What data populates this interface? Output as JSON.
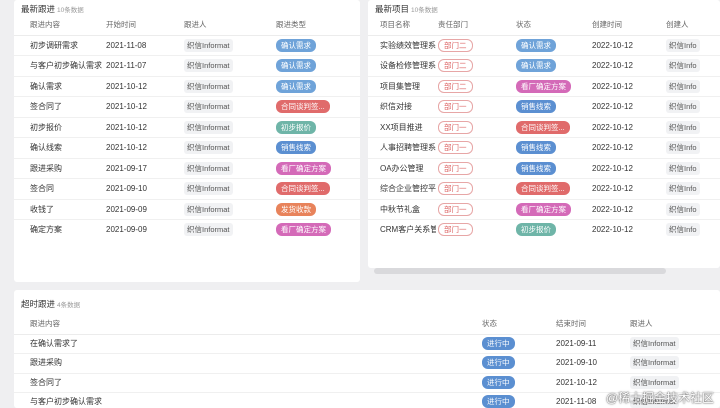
{
  "colors": {
    "需求": "#6fa3d9",
    "确认需求": "#6fa3d9",
    "合同谈判签": "#e06b6b",
    "初步报价": "#6fb5a8",
    "销售线索": "#5b8fd1",
    "看厂确定方案": "#d46ab8",
    "发货收款": "#e8835b",
    "进行中": "#5b8fd1"
  },
  "recent_followups": {
    "title": "最新跟进",
    "count": "10条数据",
    "headers": [
      "跟进内容",
      "开始时间",
      "跟进人",
      "跟进类型"
    ],
    "rows": [
      {
        "content": "初步调研需求",
        "time": "2021-11-08",
        "person": "织信Informat",
        "type": "确认需求",
        "type_key": "确认需求"
      },
      {
        "content": "与客户初步确认需求",
        "time": "2021-11-07",
        "person": "织信Informat",
        "type": "确认需求",
        "type_key": "确认需求"
      },
      {
        "content": "确认需求",
        "time": "2021-10-12",
        "person": "织信Informat",
        "type": "确认需求",
        "type_key": "确认需求"
      },
      {
        "content": "签合同了",
        "time": "2021-10-12",
        "person": "织信Informat",
        "type": "合同谈判签...",
        "type_key": "合同谈判签"
      },
      {
        "content": "初步报价",
        "time": "2021-10-12",
        "person": "织信Informat",
        "type": "初步报价",
        "type_key": "初步报价"
      },
      {
        "content": "确认线索",
        "time": "2021-10-12",
        "person": "织信Informat",
        "type": "销售线索",
        "type_key": "销售线索"
      },
      {
        "content": "跟进采购",
        "time": "2021-09-17",
        "person": "织信Informat",
        "type": "看厂确定方案",
        "type_key": "看厂确定方案"
      },
      {
        "content": "签合同",
        "time": "2021-09-10",
        "person": "织信Informat",
        "type": "合同谈判签...",
        "type_key": "合同谈判签"
      },
      {
        "content": "收钱了",
        "time": "2021-09-09",
        "person": "织信Informat",
        "type": "发货收款",
        "type_key": "发货收款"
      },
      {
        "content": "确定方案",
        "time": "2021-09-09",
        "person": "织信Informat",
        "type": "看厂确定方案",
        "type_key": "看厂确定方案"
      }
    ]
  },
  "recent_projects": {
    "title": "最新项目",
    "count": "10条数据",
    "headers": [
      "项目名称",
      "责任部门",
      "状态",
      "创建时间",
      "创建人"
    ],
    "rows": [
      {
        "name": "实验绩效管理系",
        "dept": "部门二",
        "status": "确认需求",
        "status_key": "确认需求",
        "date": "2022-10-12",
        "creator": "织信Info"
      },
      {
        "name": "设备检修管理系",
        "dept": "部门二",
        "status": "确认需求",
        "status_key": "确认需求",
        "date": "2022-10-12",
        "creator": "织信Info"
      },
      {
        "name": "项目集管理",
        "dept": "部门二",
        "status": "看厂确定方案",
        "status_key": "看厂确定方案",
        "date": "2022-10-12",
        "creator": "织信Info"
      },
      {
        "name": "织信对接",
        "dept": "部门一",
        "status": "销售线索",
        "status_key": "销售线索",
        "date": "2022-10-12",
        "creator": "织信Info"
      },
      {
        "name": "XX项目推进",
        "dept": "部门一",
        "status": "合同谈判签...",
        "status_key": "合同谈判签",
        "date": "2022-10-12",
        "creator": "织信Info"
      },
      {
        "name": "人事招聘管理系",
        "dept": "部门一",
        "status": "销售线索",
        "status_key": "销售线索",
        "date": "2022-10-12",
        "creator": "织信Info"
      },
      {
        "name": "OA办公管理",
        "dept": "部门一",
        "status": "销售线索",
        "status_key": "销售线索",
        "date": "2022-10-12",
        "creator": "织信Info"
      },
      {
        "name": "综合企业管控平",
        "dept": "部门一",
        "status": "合同谈判签...",
        "status_key": "合同谈判签",
        "date": "2022-10-12",
        "creator": "织信Info"
      },
      {
        "name": "中秋节礼盒",
        "dept": "部门一",
        "status": "看厂确定方案",
        "status_key": "看厂确定方案",
        "date": "2022-10-12",
        "creator": "织信Info"
      },
      {
        "name": "CRM客户关系管",
        "dept": "部门一",
        "status": "初步报价",
        "status_key": "初步报价",
        "date": "2022-10-12",
        "creator": "织信Info"
      }
    ]
  },
  "overdue_followups": {
    "title": "超时跟进",
    "count": "4条数据",
    "headers": [
      "跟进内容",
      "状态",
      "结束时间",
      "跟进人"
    ],
    "rows": [
      {
        "content": "在确认需求了",
        "status": "进行中",
        "date": "2021-09-11",
        "person": "织信Informat"
      },
      {
        "content": "跟进采购",
        "status": "进行中",
        "date": "2021-09-10",
        "person": "织信Informat"
      },
      {
        "content": "签合同了",
        "status": "进行中",
        "date": "2021-10-12",
        "person": "织信Informat"
      },
      {
        "content": "与客户初步确认需求",
        "status": "进行中",
        "date": "2021-11-08",
        "person": "织信Informat"
      }
    ]
  },
  "watermark": "@稀土掘金技术社区"
}
